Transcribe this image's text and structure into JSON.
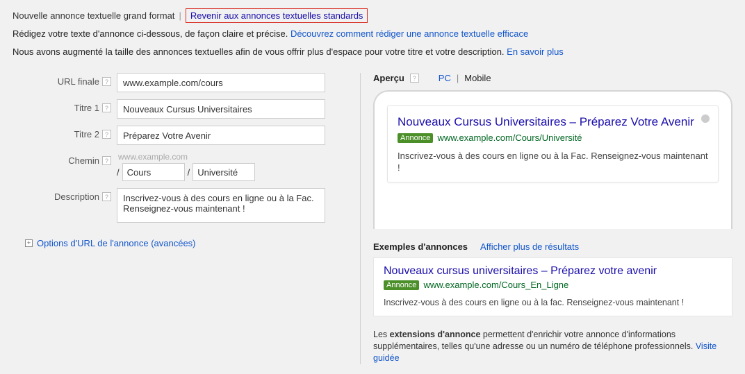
{
  "header": {
    "title": "Nouvelle annonce textuelle grand format",
    "pipe": "|",
    "revert_link": "Revenir aux annonces textuelles standards",
    "line2_pre": "Rédigez votre texte d'annonce ci-dessous, de façon claire et précise. ",
    "line2_link": "Découvrez comment rédiger une annonce textuelle efficace",
    "line3_pre": "Nous avons augmenté la taille des annonces textuelles afin de vous offrir plus d'espace pour votre titre et votre description. ",
    "line3_link": "En savoir plus"
  },
  "form": {
    "url_label": "URL finale",
    "url_value": "www.example.com/cours",
    "title1_label": "Titre 1",
    "title1_value": "Nouveaux Cursus Universitaires",
    "title2_label": "Titre 2",
    "title2_value": "Préparez Votre Avenir",
    "path_label": "Chemin",
    "path_domain": "www.example.com",
    "path_slash": "/",
    "path_1": "Cours",
    "path_2": "Université",
    "desc_label": "Description",
    "desc_value": "Inscrivez-vous à des cours en ligne ou à la Fac. Renseignez-vous maintenant !",
    "help_q": "?"
  },
  "advanced": {
    "label": "Options d'URL de l'annonce (avancées)",
    "plus": "+"
  },
  "preview": {
    "label": "Aperçu",
    "pc": "PC",
    "sep": "|",
    "mobile": "Mobile",
    "ad_title": "Nouveaux Cursus Universitaires – Préparez Votre Avenir",
    "ad_badge": "Annonce",
    "ad_url": "www.example.com/Cours/Université",
    "ad_desc": "Inscrivez-vous à des cours en ligne ou à la Fac. Renseignez-vous maintenant !"
  },
  "examples": {
    "header": "Exemples d'annonces",
    "more_link": "Afficher plus de résultats",
    "ad_title": "Nouveaux cursus universitaires – Préparez votre avenir",
    "ad_badge": "Annonce",
    "ad_url": "www.example.com/Cours_En_Ligne",
    "ad_desc": "Inscrivez-vous à des cours en ligne ou à la fac. Renseignez-vous maintenant !"
  },
  "extensions": {
    "pre": "Les ",
    "bold": "extensions d'annonce",
    "mid": " permettent d'enrichir votre annonce d'informations supplémentaires, telles qu'une adresse ou un numéro de téléphone professionnels. ",
    "link": "Visite guidée"
  }
}
